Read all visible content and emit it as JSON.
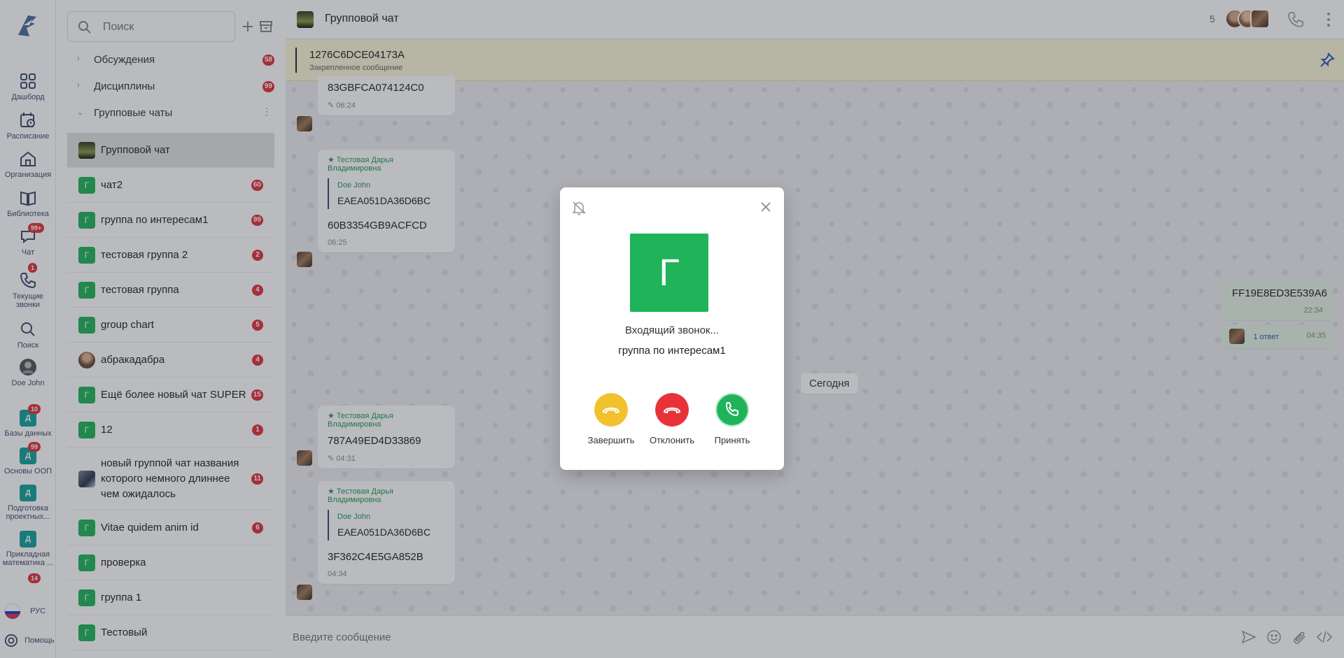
{
  "rail": {
    "items": [
      {
        "label": "Дашборд",
        "icon": "dashboard-icon"
      },
      {
        "label": "Расписание",
        "icon": "schedule-icon"
      },
      {
        "label": "Организация",
        "icon": "organization-icon"
      },
      {
        "label": "Библиотека",
        "icon": "library-icon"
      },
      {
        "label": "Чат",
        "icon": "chat-icon",
        "badge": "99+"
      },
      {
        "label": "Текущие звонки",
        "icon": "phone-icon",
        "badge": "1"
      },
      {
        "label": "Поиск",
        "icon": "search-icon"
      },
      {
        "label": "Doe John",
        "icon": "avatar"
      }
    ],
    "courses": [
      {
        "letter": "Д",
        "label": "Базы данных",
        "badge": "10"
      },
      {
        "letter": "Д",
        "label": "Основы ООП",
        "badge": "99"
      },
      {
        "letter": "Д",
        "label": "Подготовка проектных..."
      },
      {
        "letter": "Д",
        "label": "Прикладная математика ..."
      }
    ],
    "partial_badge": "14",
    "language": "РУС",
    "help": "Помощь"
  },
  "panel": {
    "search_placeholder": "Поиск",
    "sections": [
      {
        "label": "Обсуждения",
        "badge": "58"
      },
      {
        "label": "Дисциплины",
        "badge": "99"
      },
      {
        "label": "Групповые чаты"
      }
    ],
    "chats": [
      {
        "letter": "",
        "name": "Групповой чат",
        "badge": ""
      },
      {
        "letter": "Г",
        "name": "чат2",
        "badge": "60"
      },
      {
        "letter": "Г",
        "name": "группа по интересам1",
        "badge": "99"
      },
      {
        "letter": "Г",
        "name": "тестовая группа 2",
        "badge": "2"
      },
      {
        "letter": "Г",
        "name": "тестовая группа",
        "badge": "4"
      },
      {
        "letter": "Г",
        "name": "group chart",
        "badge": "5"
      },
      {
        "letter": "",
        "name": "абракадабра",
        "badge": "4"
      },
      {
        "letter": "Г",
        "name": "Ещё более новый чат SUPER",
        "badge": "15"
      },
      {
        "letter": "Г",
        "name": "12",
        "badge": "1"
      },
      {
        "letter": "",
        "name": "новый группой чат названия которого немного длиннее чем ожидалось",
        "badge": "11"
      },
      {
        "letter": "Г",
        "name": "Vitae quidem anim id",
        "badge": "6"
      },
      {
        "letter": "Г",
        "name": "проверка",
        "badge": ""
      },
      {
        "letter": "Г",
        "name": "группа 1",
        "badge": ""
      },
      {
        "letter": "Г",
        "name": "Тестовый",
        "badge": ""
      }
    ]
  },
  "chat": {
    "title": "Групповой чат",
    "member_count": "5",
    "pinned": {
      "code": "1276C6DCE04173A",
      "subtitle": "Закрепленное сообщение"
    },
    "messages": [
      {
        "text": "83GBFCA074124C0",
        "time": "06:24"
      },
      {
        "author": "Тестовая Дарья Владимировна",
        "quote_author": "Doe John",
        "quote_text": "EAEA051DA36D6BC",
        "text": "60B3354GB9ACFCD",
        "time": "06:25"
      },
      {
        "text": "FF19E8ED3E539A6",
        "time": "22:34",
        "reply_label": "1 ответ",
        "reply_time": "04:35"
      },
      {
        "author": "Тестовая Дарья Владимировна",
        "text": "787A49ED4D33869",
        "time": "04:31"
      },
      {
        "author": "Тестовая Дарья Владимировна",
        "quote_author": "Doe John",
        "quote_text": "EAEA051DA36D6BC",
        "text": "3F362C4E5GA852B",
        "time": "04:34"
      }
    ],
    "date_chip": "Сегодня",
    "composer_placeholder": "Введите сообщение"
  },
  "call": {
    "avatar_letter": "Г",
    "incoming": "Входящий звонок...",
    "callee": "группа по интересам1",
    "buttons": [
      {
        "label": "Завершить",
        "color": "#f2c12e"
      },
      {
        "label": "Отклонить",
        "color": "#e8323a"
      },
      {
        "label": "Принять",
        "color": "#1fb45a"
      }
    ]
  }
}
